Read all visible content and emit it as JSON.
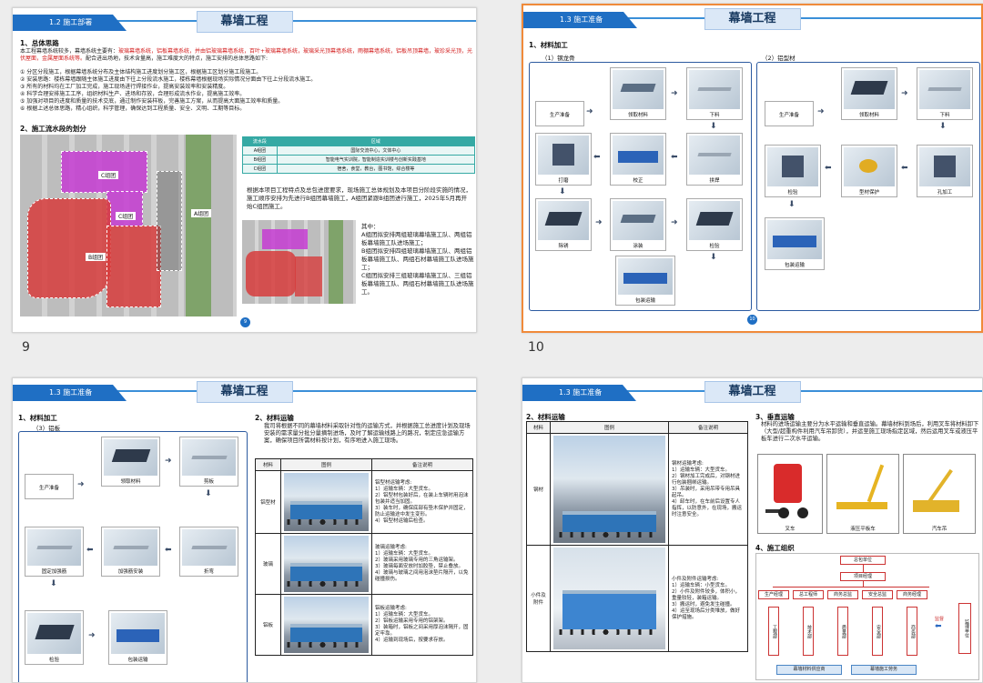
{
  "slides": [
    {
      "number": "9",
      "badge": "9",
      "tab": "1.2 施工部署",
      "title": "幕墙工程",
      "h1": "1、总体思路",
      "p1_a": "本工程幕墙系统较多，幕墙系统主要有：",
      "p1_red": "玻璃幕墙系统，铝板幕墙系统，并由铝玻璃幕墙系统，百叶+玻璃幕墙系统，玻璃采光顶幕墙系统，雨棚幕墙系统，铝板吊顶幕墙，玻珍采光顶，光伏屋面，金属屋面系统等。",
      "p1_b": "配合进出场地，技术含量高，施工难度大的特点，施工安排的总体思路如下:",
      "points": [
        "① 分区分段施工，根据幕墙系统分布及主体结构施工进度划分施工区，根据施工区划分施工段施工。",
        "② 安装思路：楼栋幕墙跟随主体施工进度由下往上分段流水施工，楼栋幕墙根据现场实际情况分面由下往上分段流水施工。",
        "③ 所有的材料均在工厂加工完成，施工现场进行焊接作业，提高安装效率和安装精度。",
        "④ 科学合理安排施工工序，组织材料生产、进场和存放，合理形成流水作业，提高施工效率。",
        "⑤ 加强对项目的进度和质量的技术交底，通过制作安装样板，完善施工方案，从而提高大面施工效率和质量。",
        "⑥ 根据上述总体思路，精心组织，科学管理，确保达到工程质量、安全、文明、工期等目标。"
      ],
      "h2": "2、施工流水段的划分",
      "zones": [
        "C组团",
        "C组团",
        "A组团",
        "B组团"
      ],
      "zone_table": {
        "headers": [
          "流水段",
          "区域"
        ],
        "rows": [
          [
            "A组团",
            "国际交流中心，文体中心"
          ],
          [
            "B组团",
            "智能电气实训院，智能制造实训楼与创新实践基地"
          ],
          [
            "C组团",
            "宿舍，食堂，教台，图书馆，综合楼等"
          ]
        ]
      },
      "intro": "根据本项目工程特点及总包进度要求，现场施工总体规划及本项目分阶段实施的情况，施工顺序安排为先进行B组团幕墙施工，A组团紧跟B组团进行施工，2025年5月再开始C组团施工。",
      "sub": [
        "其中：",
        "A组团拟安排两组玻璃幕墙施工队、两组铝板幕墙施工队进场施工；",
        "B组团拟安排四组玻璃幕墙施工队、两组铝板幕墙施工队、两组石材幕墙施工队进场施工；",
        "C组团拟安排三组玻璃幕墙施工队、三组铝板幕墙施工队、两组石材幕墙施工队进场施工。"
      ]
    },
    {
      "number": "10",
      "badge": "10",
      "tab": "1.3 施工准备",
      "title": "幕墙工程",
      "h1": "1、材料加工",
      "left_label": "（1）钢龙骨",
      "right_label": "（2）铝型材",
      "left_steps": [
        "生产准备",
        "领取材料",
        "下料",
        "打磨",
        "校正",
        "拼焊",
        "除锈",
        "涂装",
        "检验",
        "包装运输"
      ],
      "right_steps": [
        "生产准备",
        "领取材料",
        "下料",
        "检验",
        "型材保护",
        "孔加工",
        "包装运输"
      ]
    },
    {
      "tab": "1.3 施工准备",
      "title": "幕墙工程",
      "h1": "1、材料加工",
      "left_label": "（3）铝板",
      "steps": [
        "生产准备",
        "领取材料",
        "剪板",
        "固定加强筋",
        "加强筋安装",
        "折弯",
        "检验",
        "包装运输"
      ],
      "h2": "2、材料运输",
      "intro": "我司将根据不同的幕墙材料采取针对性的运输方式，并根据施工总进度计划及现场安装的需求量分批分量摘制进场，及时了解运输线路上的路况，制定应急运输方案，确保项目所需材料按计划，有序地进入施工现场。",
      "headers": [
        "材料",
        "图例",
        "备注说明"
      ],
      "rows": [
        {
          "mat": "铝型材",
          "note": "铝型材运输考虑:\n1）运输车辆：大型货车。\n2）铝型材包装好后，在装上车辆时用泡沫包装并适当加固。\n3）装车时，确保底部有垫木保护并固定，防止运输途中发生变形。\n4）铝型材运输后检查。"
        },
        {
          "mat": "玻璃",
          "note": "玻璃运输考虑:\n1）运输车辆：大型货车。\n2）玻璃采用玻璃专用的三角运输架。\n3）玻璃每面安放时加胶垫，禁止叠放。\n4）玻璃与玻璃之间用泡沫垫片隔开，以免碰撞损伤。"
        },
        {
          "mat": "铝板",
          "note": "铝板运输考虑:\n1）运输车辆：大型货车。\n2）铝板运输采用专用的铝架架。\n3）装箱时，铝板之间采用厚泡沫隔开，固定牢靠。\n4）运输到现场后，按要求存放。"
        }
      ]
    },
    {
      "tab": "1.3 施工准备",
      "title": "幕墙工程",
      "h1": "2、材料运输",
      "headers": [
        "材料",
        "图例",
        "备注说明"
      ],
      "rows": [
        {
          "mat": "钢材",
          "note": "钢材运输考虑:\n1）运输车辆：大型货车。\n2）钢材加工完成后，对钢材进行包装捆绑运输。\n3）吊装时，采用吊带专用吊具起吊。\n4）卸车时，在车前后设置专人指挥，以防意外，在现场，搬运时注意安全。"
        },
        {
          "mat": "小件及附件",
          "note": "小件及附件运输考虑:\n1）运输车辆：小型货车。\n2）小件及附件较多，体积小，重量较轻，装箱运输。\n3）搬运时，避免发生碰撞。\n4）运至现场后分类堆放，做好保护措施。"
        }
      ],
      "h2": "3、垂直运输",
      "h2_text": "材料的进场运输主要分为水平运输和垂直运输。幕墙材料到场后，利用叉车将材料卸下（大型/超重构件利用汽车吊卸货），并运至施工现场指定区域，然后运用叉车或液压平板车进行二次水平运输。",
      "equip": [
        "叉车",
        "液压平板车",
        "汽车吊"
      ],
      "h3": "4、施工组织",
      "org_top": "总包单位",
      "org_pm": "项目经理",
      "org_mid": [
        "生产经理",
        "总工程师",
        "商务总监",
        "安全总监",
        "商务经理"
      ],
      "org_depts": [
        "工程部",
        "技术部",
        "质量部",
        "安全部",
        "商务部"
      ],
      "org_sup": "监督",
      "org_right": "监理单位",
      "org_bottom": [
        "幕墙材料供应商",
        "幕墙施工劳务"
      ]
    }
  ],
  "colors": {
    "accent": "#1f6fc4",
    "selected_border": "#f08a3a",
    "teal": "#35a9a4",
    "red_text": "#d21a1a"
  }
}
